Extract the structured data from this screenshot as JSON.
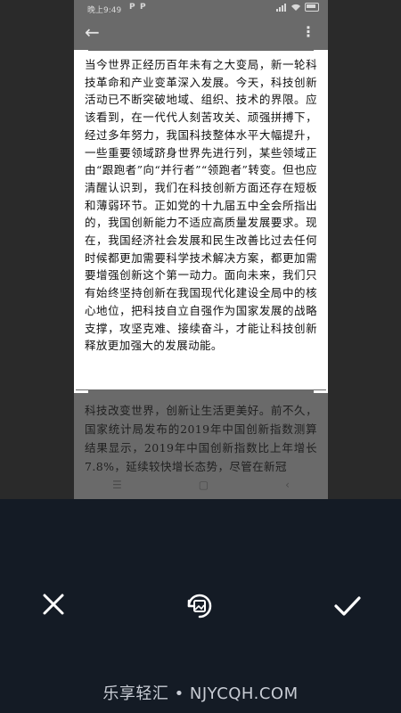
{
  "status_bar": {
    "time": "晚上9:49",
    "notification_p1": "P",
    "notification_p2": "P",
    "battery_icon": "battery-charging-icon",
    "signal_icon": "signal-icon",
    "wifi_icon": "wifi-icon"
  },
  "appbar": {
    "back_icon": "back-arrow-icon",
    "more_icon": "more-vertical-icon"
  },
  "document": {
    "paragraph": "当今世界正经历百年未有之大变局，新一轮科技革命和产业变革深入发展。今天，科技创新活动已不断突破地域、组织、技术的界限。应该看到，在一代代人刻苦攻关、顽强拼搏下，经过多年努力，我国科技整体水平大幅提升，一些重要领域跻身世界先进行列，某些领域正由“跟跑者”向“并行者”“领跑者”转变。但也应清醒认识到，我们在科技创新方面还存在短板和薄弱环节。正如党的十九届五中全会所指出的，我国创新能力不适应高质量发展要求。现在，我国经济社会发展和民生改善比过去任何时候都更加需要科学技术解决方案，都更加需要增强创新这个第一动力。面向未来，我们只有始终坚持创新在我国现代化建设全局中的核心地位，把科技自立自强作为国家发展的战略支撑，攻坚克难、接续奋斗，才能让科技创新释放更加强大的发展动能。"
  },
  "below_crop": {
    "paragraph": "科技改变世界，创新让生活更美好。前不久，国家统计局发布的2019年中国创新指数测算结果显示，2019年中国创新指数比上年增长7.8%，延续较快增长态势，尽管在新冠"
  },
  "controls": {
    "cancel_icon": "close-icon",
    "rotate_icon": "rotate-image-icon",
    "confirm_icon": "checkmark-icon"
  },
  "watermark": {
    "text": "乐享轻汇 • NJYCQH.COM"
  }
}
